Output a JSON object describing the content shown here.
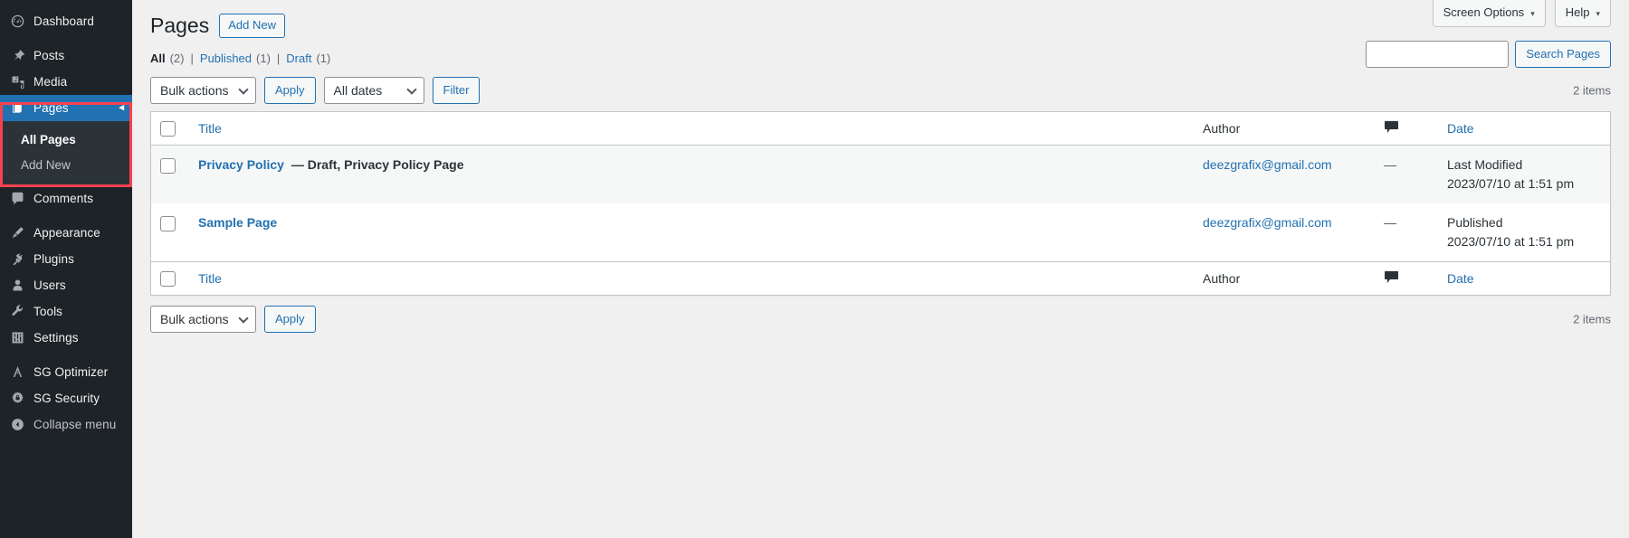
{
  "sidebar": {
    "items": [
      {
        "label": "Dashboard",
        "icon": "dashboard-icon",
        "name": "dashboard",
        "gap_before": false
      },
      {
        "label": "Posts",
        "icon": "pin-icon",
        "name": "posts",
        "gap_before": true
      },
      {
        "label": "Media",
        "icon": "media-icon",
        "name": "media",
        "gap_before": false
      },
      {
        "label": "Pages",
        "icon": "pages-icon",
        "name": "pages",
        "gap_before": false,
        "current": true
      },
      {
        "label": "Comments",
        "icon": "comment-icon",
        "name": "comments",
        "gap_before": false
      },
      {
        "label": "Appearance",
        "icon": "brush-icon",
        "name": "appearance",
        "gap_before": true
      },
      {
        "label": "Plugins",
        "icon": "plug-icon",
        "name": "plugins",
        "gap_before": false
      },
      {
        "label": "Users",
        "icon": "user-icon",
        "name": "users",
        "gap_before": false
      },
      {
        "label": "Tools",
        "icon": "wrench-icon",
        "name": "tools",
        "gap_before": false
      },
      {
        "label": "Settings",
        "icon": "sliders-icon",
        "name": "settings",
        "gap_before": false
      },
      {
        "label": "SG Optimizer",
        "icon": "sg-optimizer-icon",
        "name": "sg-optimizer",
        "gap_before": true
      },
      {
        "label": "SG Security",
        "icon": "sg-security-icon",
        "name": "sg-security",
        "gap_before": false
      }
    ],
    "submenu": [
      {
        "label": "All Pages",
        "active": true
      },
      {
        "label": "Add New",
        "active": false
      }
    ],
    "collapse": {
      "label": "Collapse menu",
      "icon": "collapse-arrow-icon"
    },
    "current_arrow": "◂",
    "highlight_color": "#f8414f"
  },
  "header": {
    "screen_options": "Screen Options",
    "help": "Help",
    "caret": "▾"
  },
  "page": {
    "title": "Pages",
    "add_new": "Add New"
  },
  "filters": {
    "all_label": "All",
    "all_count": "(2)",
    "published_label": "Published",
    "published_count": "(1)",
    "draft_label": "Draft",
    "draft_count": "(1)",
    "separator": "|"
  },
  "search": {
    "value": "",
    "placeholder": "",
    "submit": "Search Pages"
  },
  "tablenav_top": {
    "bulk_actions": "Bulk actions",
    "apply": "Apply",
    "all_dates": "All dates",
    "filter": "Filter",
    "items_count": "2 items"
  },
  "tablenav_bottom": {
    "bulk_actions": "Bulk actions",
    "apply": "Apply",
    "items_count": "2 items"
  },
  "table": {
    "columns": {
      "title": "Title",
      "author": "Author",
      "comments": "💬",
      "date": "Date"
    },
    "rows": [
      {
        "title": "Privacy Policy",
        "state": "— Draft, Privacy Policy Page",
        "author": "deezgrafix@gmail.com",
        "comments": "—",
        "date_label": "Last Modified",
        "date_value": "2023/07/10 at 1:51 pm"
      },
      {
        "title": "Sample Page",
        "state": "",
        "author": "deezgrafix@gmail.com",
        "comments": "—",
        "date_label": "Published",
        "date_value": "2023/07/10 at 1:51 pm"
      }
    ]
  },
  "colors": {
    "sidebar_bg": "#1d2327",
    "sidebar_submenu_bg": "#2c3338",
    "accent_blue": "#2271b1",
    "current_menu_bg": "#2271b1",
    "page_bg": "#f0f0f1",
    "highlight_red": "#f8414f"
  }
}
